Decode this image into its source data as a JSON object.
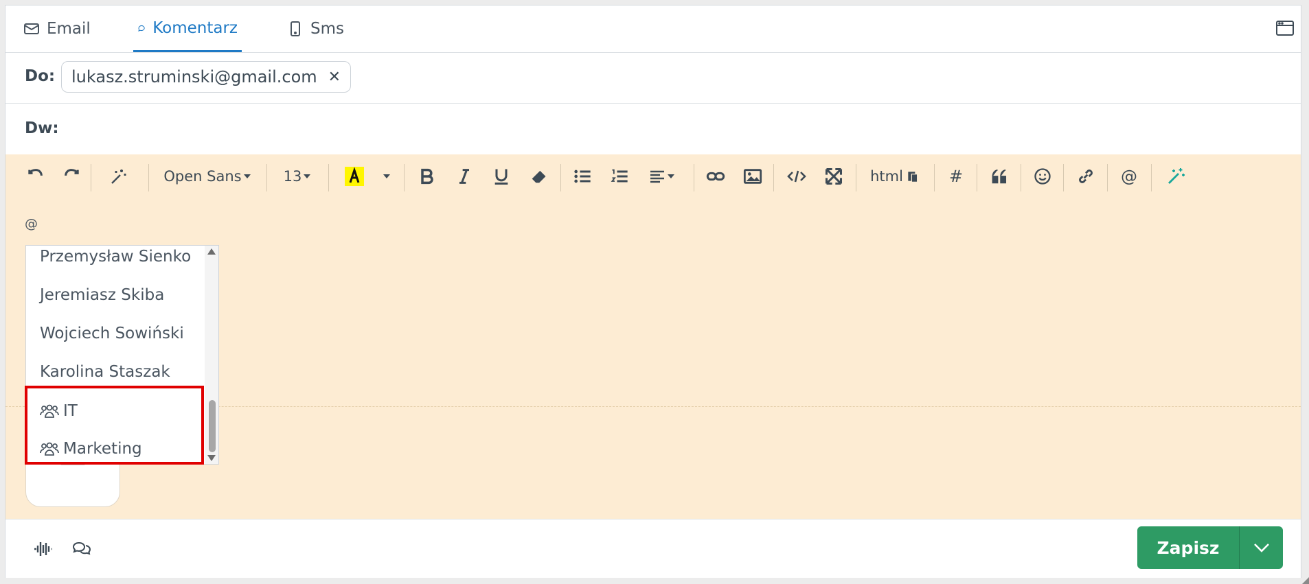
{
  "tabs": [
    {
      "label": "Email",
      "icon": "envelope-icon",
      "active": false
    },
    {
      "label": "Komentarz",
      "icon": "chat-bubble-icon",
      "active": true
    },
    {
      "label": "Sms",
      "icon": "phone-icon",
      "active": false
    }
  ],
  "recipients": {
    "to_label": "Do:",
    "to_value": "lukasz.struminski@gmail.com",
    "remove_symbol": "✕",
    "cc_label": "Dw:"
  },
  "toolbar": {
    "font_family": "Open Sans",
    "font_size": "13",
    "html_label": "html",
    "hash_label": "#",
    "at_label": "@"
  },
  "editor": {
    "content_text": "@"
  },
  "mention_dropdown": {
    "items": [
      {
        "label": "Przemysław Sienko",
        "type": "user"
      },
      {
        "label": "Jeremiasz Skiba",
        "type": "user"
      },
      {
        "label": "Wojciech Sowiński",
        "type": "user"
      },
      {
        "label": "Karolina Staszak",
        "type": "user"
      },
      {
        "label": "IT",
        "type": "group"
      },
      {
        "label": "Marketing",
        "type": "group"
      }
    ]
  },
  "footer": {
    "save_label": "Zapisz"
  },
  "colors": {
    "accent": "#1f7ac5",
    "editor_bg": "#fdecd3",
    "save_bg": "#2e9b64",
    "highlight": "#e00000"
  }
}
